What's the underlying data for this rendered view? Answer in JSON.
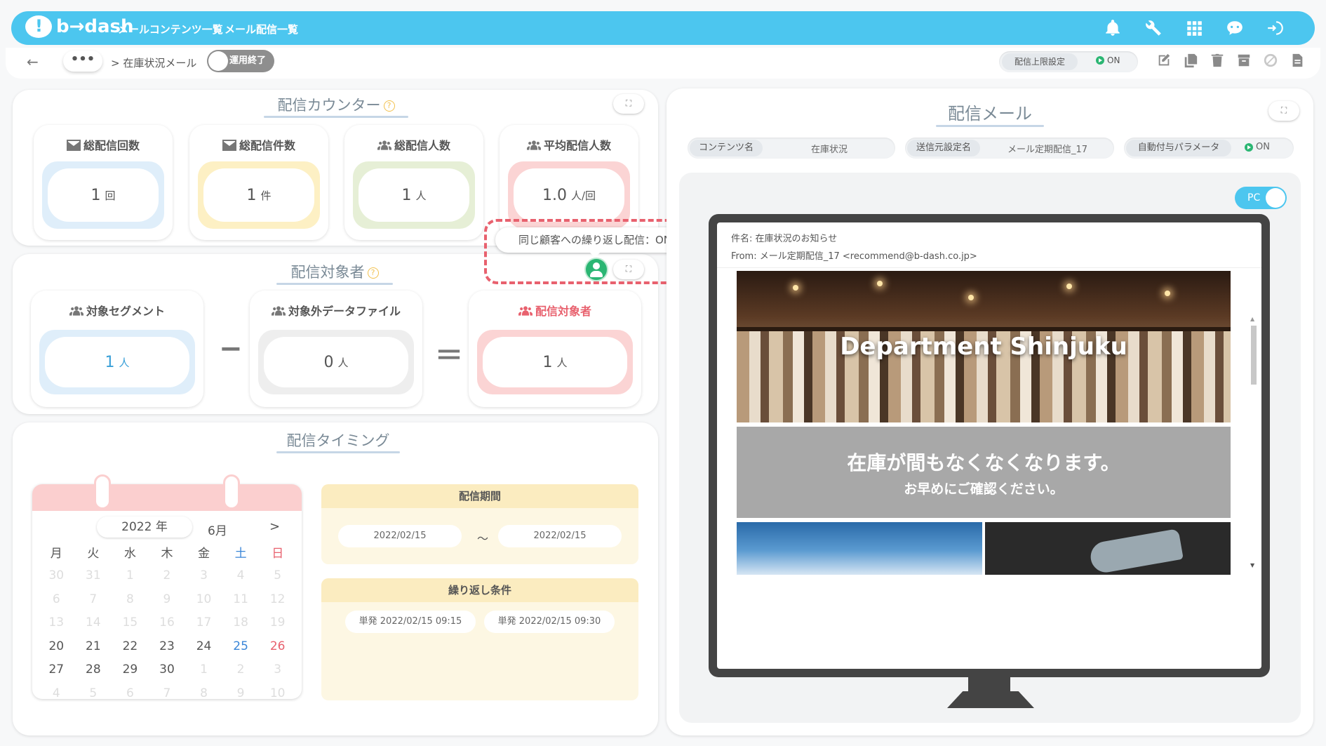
{
  "header": {
    "logo": "b→dash",
    "nav": [
      "メールコンテンツ一覧",
      "メール配信一覧"
    ]
  },
  "subheader": {
    "back": "←",
    "more": "•••",
    "breadcrumb": "> 在庫状況メール",
    "status_toggle": "運用終了",
    "limit_label": "配信上限設定",
    "limit_value": "ON"
  },
  "counter": {
    "title": "配信カウンター",
    "help": "?",
    "cards": [
      {
        "title": "総配信回数",
        "value": "1",
        "unit": "回",
        "color": "#dfeefa"
      },
      {
        "title": "総配信件数",
        "value": "1",
        "unit": "件",
        "color": "#fdf0c4"
      },
      {
        "title": "総配信人数",
        "value": "1",
        "unit": "人",
        "color": "#e6efd6"
      },
      {
        "title": "平均配信人数",
        "value": "1.0",
        "unit": "人/回",
        "color": "#fbd4d4"
      }
    ]
  },
  "tooltip": "同じ顧客への繰り返し配信：ON",
  "target": {
    "title": "配信対象者",
    "help": "?",
    "cards": [
      {
        "title": "対象セグメント",
        "value": "1",
        "unit": "人",
        "color": "#dfeefa"
      },
      {
        "title": "対象外データファイル",
        "value": "0",
        "unit": "人",
        "color": "#eeeeee"
      },
      {
        "title": "配信対象者",
        "value": "1",
        "unit": "人",
        "color": "#fbd4d4"
      }
    ],
    "minus": "−",
    "equals": "＝"
  },
  "timing": {
    "title": "配信タイミング",
    "calendar": {
      "year": "2022 年",
      "month": "6月",
      "next": ">",
      "weekdays": [
        "月",
        "火",
        "水",
        "木",
        "金",
        "土",
        "日"
      ],
      "weeks": [
        [
          "30",
          "31",
          "1",
          "2",
          "3",
          "4",
          "5"
        ],
        [
          "6",
          "7",
          "8",
          "9",
          "10",
          "11",
          "12"
        ],
        [
          "13",
          "14",
          "15",
          "16",
          "17",
          "18",
          "19"
        ],
        [
          "20",
          "21",
          "22",
          "23",
          "24",
          "25",
          "26"
        ],
        [
          "27",
          "28",
          "29",
          "30",
          "1",
          "2",
          "3"
        ],
        [
          "4",
          "5",
          "6",
          "7",
          "8",
          "9",
          "10"
        ]
      ]
    },
    "period": {
      "title": "配信期間",
      "start": "2022/02/15",
      "sep": "～",
      "end": "2022/02/15"
    },
    "repeat": {
      "title": "繰り返し条件",
      "items": [
        "単発 2022/02/15 09:15",
        "単発 2022/02/15 09:30"
      ]
    }
  },
  "mail": {
    "title": "配信メール",
    "content_label": "コンテンツ名",
    "content_value": "在庫状況",
    "sender_label": "送信元設定名",
    "sender_value": "メール定期配信_17",
    "param_label": "自動付与パラメータ",
    "param_value": "ON",
    "pc_toggle": "PC",
    "subject": "件名: 在庫状況のお知らせ",
    "from": "From: メール定期配信_17 <recommend@b-dash.co.jp>",
    "hero_title": "Department Shinjuku",
    "banner_line1": "在庫が間もなくなくなります。",
    "banner_line2": "お早めにご確認ください。"
  }
}
